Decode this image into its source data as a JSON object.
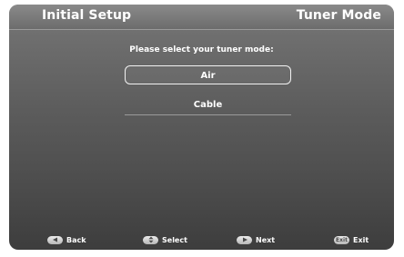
{
  "header": {
    "left_title": "Initial Setup",
    "right_title": "Tuner Mode"
  },
  "prompt": "Please select your tuner mode:",
  "options": [
    {
      "label": "Air",
      "selected": true
    },
    {
      "label": "Cable",
      "selected": false
    }
  ],
  "footer": {
    "back": {
      "label": "Back",
      "icon": "left-arrow-icon"
    },
    "select": {
      "label": "Select",
      "icon": "up-down-icon"
    },
    "next": {
      "label": "Next",
      "icon": "right-arrow-icon"
    },
    "exit": {
      "label": "Exit",
      "key_text": "Exit",
      "icon": "exit-key-icon"
    }
  },
  "colors": {
    "background_top": "#7d7d7d",
    "background_bottom": "#3d3d3d",
    "text": "#ffffff",
    "selection_border": "#f2f2f2"
  }
}
